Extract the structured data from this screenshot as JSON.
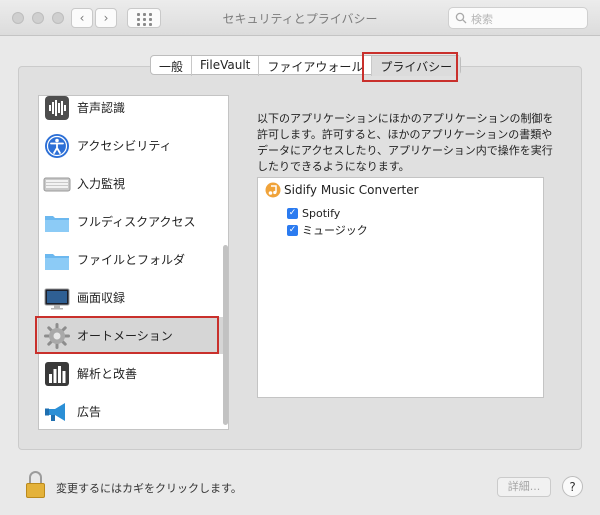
{
  "window": {
    "title": "セキュリティとプライバシー",
    "search_placeholder": "検索"
  },
  "tabs": [
    {
      "label": "一般"
    },
    {
      "label": "FileVault"
    },
    {
      "label": "ファイアウォール"
    },
    {
      "label": "プライバシー",
      "selected": true
    }
  ],
  "sidebar": {
    "items": [
      {
        "label": "音声認識",
        "icon": "waveform-icon"
      },
      {
        "label": "アクセシビリティ",
        "icon": "accessibility-icon"
      },
      {
        "label": "入力監視",
        "icon": "keyboard-icon"
      },
      {
        "label": "フルディスクアクセス",
        "icon": "folder-icon"
      },
      {
        "label": "ファイルとフォルダ",
        "icon": "folder-icon"
      },
      {
        "label": "画面収録",
        "icon": "monitor-icon"
      },
      {
        "label": "オートメーション",
        "icon": "gear-icon",
        "selected": true
      },
      {
        "label": "解析と改善",
        "icon": "bar-chart-icon"
      },
      {
        "label": "広告",
        "icon": "megaphone-icon"
      }
    ]
  },
  "main": {
    "description": "以下のアプリケーションにほかのアプリケーションの制御を許可します。許可すると、ほかのアプリケーションの書類やデータにアクセスしたり、アプリケーション内で操作を実行したりできるようになります。",
    "app": {
      "name": "Sidify Music Converter",
      "permissions": [
        {
          "label": "Spotify",
          "checked": true
        },
        {
          "label": "ミュージック",
          "checked": true
        }
      ]
    }
  },
  "footer": {
    "lock_text": "変更するにはカギをクリックします。",
    "advanced_label": "詳細...",
    "help_label": "?"
  },
  "colors": {
    "highlight": "#c9302c",
    "checkbox": "#2b7bf0"
  }
}
